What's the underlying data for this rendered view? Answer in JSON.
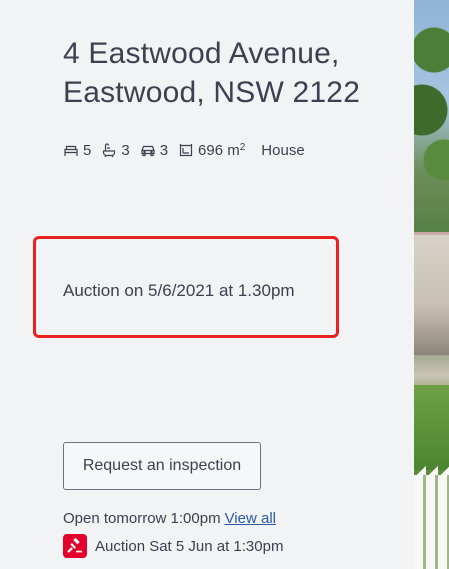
{
  "listing": {
    "address_line1": "4 Eastwood Avenue,",
    "address_line2": "Eastwood, NSW 2122"
  },
  "features": {
    "bedrooms": "5",
    "bathrooms": "3",
    "parking": "3",
    "land_size": "696 m",
    "land_unit_sup": "2",
    "property_type": "House",
    "icons": [
      "bed-icon",
      "bath-icon",
      "car-icon",
      "land-size-icon"
    ]
  },
  "auction": {
    "headline": "Auction on 5/6/2021 at 1.30pm",
    "highlight_color": "#e8231f"
  },
  "inspection": {
    "button_label": "Request an inspection",
    "open_time": "Open tomorrow 1:00pm",
    "view_all_label": "View all"
  },
  "auction_schedule": {
    "label": "Auction Sat 5 Jun at 1:30pm",
    "badge_color": "#e4002b",
    "icon": "gavel-icon"
  },
  "colors": {
    "text": "#3b4151",
    "link": "#2a59a6",
    "background": "#f2f3f5"
  }
}
